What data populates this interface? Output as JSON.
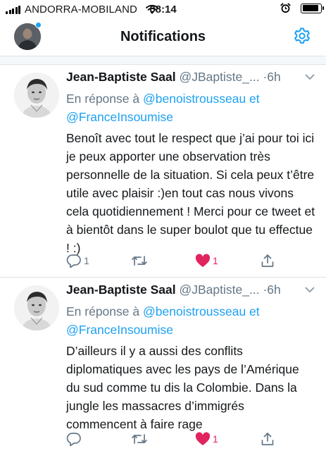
{
  "status_bar": {
    "carrier": "ANDORRA-MOBILAND",
    "time": "08:14",
    "battery_level": 0.9
  },
  "header": {
    "title": "Notifications",
    "icons": [
      "avatar",
      "gear-icon"
    ]
  },
  "tweets": [
    {
      "author": "Jean-Baptiste Saal",
      "handle": "@JBaptiste_...",
      "separator": "·",
      "time": "6h",
      "reply_prefix": "En réponse à",
      "mention1": "@benoistrousseau",
      "reply_and": "et",
      "mention2": "@FranceInsoumise",
      "text": "Benoît avec tout le respect que j’ai pour toi ici je peux apporter une observation très personnelle de la situation. Si cela peux t’être utile avec plaisir :)en tout cas nous vivons cela quotidiennement ! Merci pour ce tweet et à bientôt dans le super boulot que tu effectue ! :)",
      "reply_count": "1",
      "retweet_count": "",
      "like_count": "1"
    },
    {
      "author": "Jean-Baptiste Saal",
      "handle": "@JBaptiste_...",
      "separator": "·",
      "time": "6h",
      "reply_prefix": "En réponse à",
      "mention1": "@benoistrousseau",
      "reply_and": "et",
      "mention2": "@FranceInsoumise",
      "text": "D’ailleurs il y a aussi des conflits diplomatiques avec les pays de l’Amérique du sud comme tu dis la Colombie. Dans la jungle les massacres d’immigrés commencent à faire rage",
      "reply_count": "",
      "retweet_count": "",
      "like_count": "1"
    }
  ],
  "colors": {
    "accent": "#1da1f2",
    "like": "#e0245e",
    "secondary_text": "#657786",
    "divider": "#dfe3e7"
  }
}
